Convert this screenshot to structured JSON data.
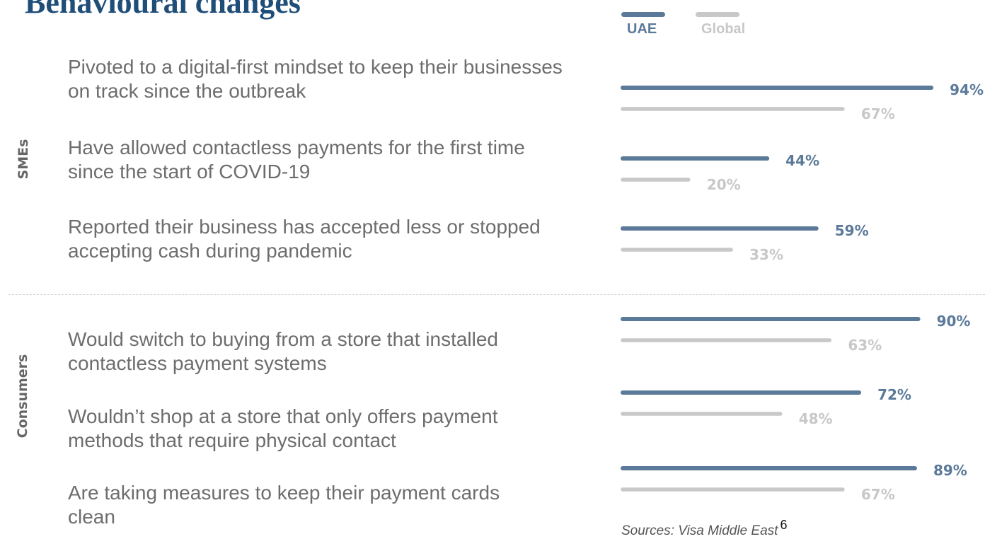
{
  "title": "Behavioural changes",
  "legend": [
    {
      "label": "UAE",
      "color": "#5b7a99"
    },
    {
      "label": "Global",
      "color": "#c8c8c8"
    }
  ],
  "sections": {
    "smes": "SMEs",
    "consumers": "Consumers"
  },
  "rows": [
    "Pivoted to a digital-first mindset to keep their businesses on track since the outbreak",
    "Have allowed contactless payments for the first time since the start of COVID-19",
    "Reported their business has accepted less or stopped accepting cash during pandemic",
    "Would switch to buying from a store that installed contactless payment systems",
    "Wouldn’t shop at a store that only offers payment methods that require physical contact",
    "Are taking measures to keep their payment cards clean"
  ],
  "chart_data": {
    "type": "bar",
    "orientation": "horizontal",
    "categories": [
      "Pivoted to a digital-first mindset to keep their businesses on track since the outbreak",
      "Have allowed contactless payments for the first time since the start of COVID-19",
      "Reported their business has accepted less or stopped accepting cash during pandemic",
      "Would switch to buying from a store that installed contactless payment systems",
      "Wouldn’t shop at a store that only offers payment methods that require physical contact",
      "Are taking measures to keep their payment cards clean"
    ],
    "series": [
      {
        "name": "UAE",
        "values": [
          94,
          44,
          59,
          90,
          72,
          89
        ],
        "labels": [
          "94%",
          "44%",
          "59%",
          "90%",
          "72%",
          "89%"
        ],
        "color": "#5b7a99"
      },
      {
        "name": "Global",
        "values": [
          67,
          20,
          33,
          63,
          48,
          67
        ],
        "labels": [
          "67%",
          "20%",
          "33%",
          "63%",
          "48%",
          "67%"
        ],
        "color": "#c8c8c8"
      }
    ],
    "xlim": [
      0,
      100
    ],
    "unit": "%",
    "legend_position": "top",
    "grid": false
  },
  "source": {
    "text": "Sources: Visa Middle East",
    "footnote": "6"
  }
}
